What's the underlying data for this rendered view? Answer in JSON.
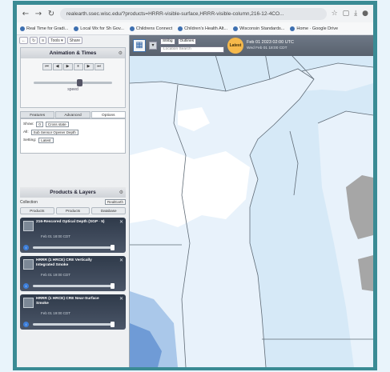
{
  "browser": {
    "url": "realearth.ssec.wisc.edu/?products=HRRR-visible-surface,HRRR-visible-column,216-12-4CO...",
    "bookmarks": [
      "Real Time for Gradi...",
      "Local Wx for Sh Gov...",
      "Childrens Connect",
      "Children's Health Alt...",
      "Wisconsin Standards...",
      "Home · Google Drive"
    ]
  },
  "left_panel": {
    "top_buttons": [
      "←",
      "↻",
      "≡",
      "Tools ▾",
      "Share"
    ],
    "animation": {
      "title": "Animation & Times",
      "controls": [
        "⏮",
        "◀",
        "▶",
        "⏸",
        "▶",
        "⏭"
      ],
      "speed_label": "speed",
      "tabs": [
        "Features",
        "Advanced",
        "Options"
      ],
      "options": [
        {
          "label": "Show:",
          "value": "0",
          "extra": "Cross state"
        },
        {
          "label": "All:",
          "value": "Sub Sensor Opener Depth"
        },
        {
          "label": "Setting:",
          "value": "Latest"
        }
      ]
    },
    "products": {
      "title": "Products & Layers",
      "collection_label": "Collection",
      "collection_value": "RealEarth",
      "tabs": [
        "Products",
        "Products",
        "Database"
      ],
      "layers": [
        {
          "title": "216-Rescored Optical Depth (SGP · 5)",
          "date": "Feb 01 18:00 CDT"
        },
        {
          "title": "HRRR (1 HRCE) CRE Vertically Integrated Smoke",
          "date": "Feb 01 19:00 CDT"
        },
        {
          "title": "HRRR (1 HRCE) CRE Near-Surface Smoke",
          "date": "Feb 01 19:00 CDT"
        }
      ]
    }
  },
  "map": {
    "toolbar": {
      "layer_select": "Stribg",
      "basemap_select": "Outlines",
      "search_placeholder": "Location Search",
      "clock_label": "Latest",
      "time_main": "Feb 01 2023 02:00 UTC",
      "time_sub": "Wed Feb 01 18:00 CDT"
    },
    "colors": {
      "water": "#d6e9f7",
      "land": "#e8f2fb",
      "snow": "#ffffff",
      "smoke_light": "#aac8ea",
      "smoke_dark": "#6f9bd6",
      "gray_region": "#a6a6a6",
      "outline": "#5f6b76"
    }
  }
}
